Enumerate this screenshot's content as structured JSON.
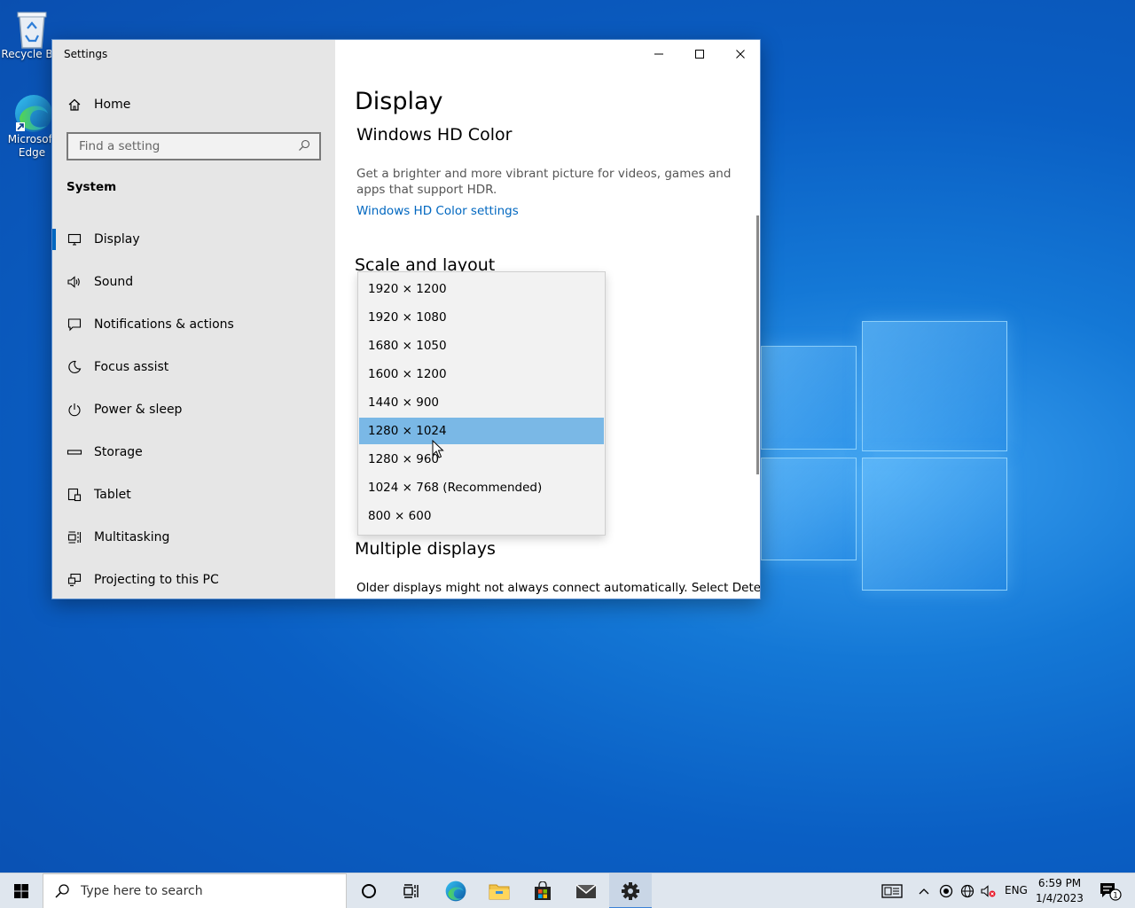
{
  "desktop": {
    "icons": [
      {
        "label": "Recycle Bin"
      },
      {
        "label": "Microsoft Edge"
      }
    ]
  },
  "window": {
    "title": "Settings",
    "controls": {
      "minimize": "minimize",
      "maximize": "maximize",
      "close": "close"
    }
  },
  "sidebar": {
    "home_label": "Home",
    "search_placeholder": "Find a setting",
    "section_label": "System",
    "items": [
      {
        "label": "Display",
        "icon": "monitor-icon",
        "active": true
      },
      {
        "label": "Sound",
        "icon": "speaker-icon"
      },
      {
        "label": "Notifications & actions",
        "icon": "notification-icon"
      },
      {
        "label": "Focus assist",
        "icon": "moon-icon"
      },
      {
        "label": "Power & sleep",
        "icon": "power-icon"
      },
      {
        "label": "Storage",
        "icon": "storage-icon"
      },
      {
        "label": "Tablet",
        "icon": "tablet-icon"
      },
      {
        "label": "Multitasking",
        "icon": "multitasking-icon"
      },
      {
        "label": "Projecting to this PC",
        "icon": "projecting-icon"
      }
    ]
  },
  "main": {
    "title": "Display",
    "hd_color_heading": "Windows HD Color",
    "hd_color_description": "Get a brighter and more vibrant picture for videos, games and apps that support HDR.",
    "hd_color_link": "Windows HD Color settings",
    "scale_heading": "Scale and layout",
    "multiple_displays_heading": "Multiple displays",
    "multiple_displays_description": "Older displays might not always connect automatically. Select Detect"
  },
  "resolution_dropdown": {
    "options": [
      "1920 × 1200",
      "1920 × 1080",
      "1680 × 1050",
      "1600 × 1200",
      "1440 × 900",
      "1280 × 1024",
      "1280 × 960",
      "1024 × 768 (Recommended)",
      "800 × 600"
    ],
    "selected": "1280 × 1024"
  },
  "taskbar": {
    "search_placeholder": "Type here to search",
    "language": "ENG",
    "time": "6:59 PM",
    "date": "1/4/2023",
    "notification_count": "1"
  },
  "colors": {
    "accent": "#0067c0",
    "selection": "#7ab8e6",
    "sidebar_bg": "#e6e6e6",
    "taskbar_bg": "#dfe6ee"
  }
}
